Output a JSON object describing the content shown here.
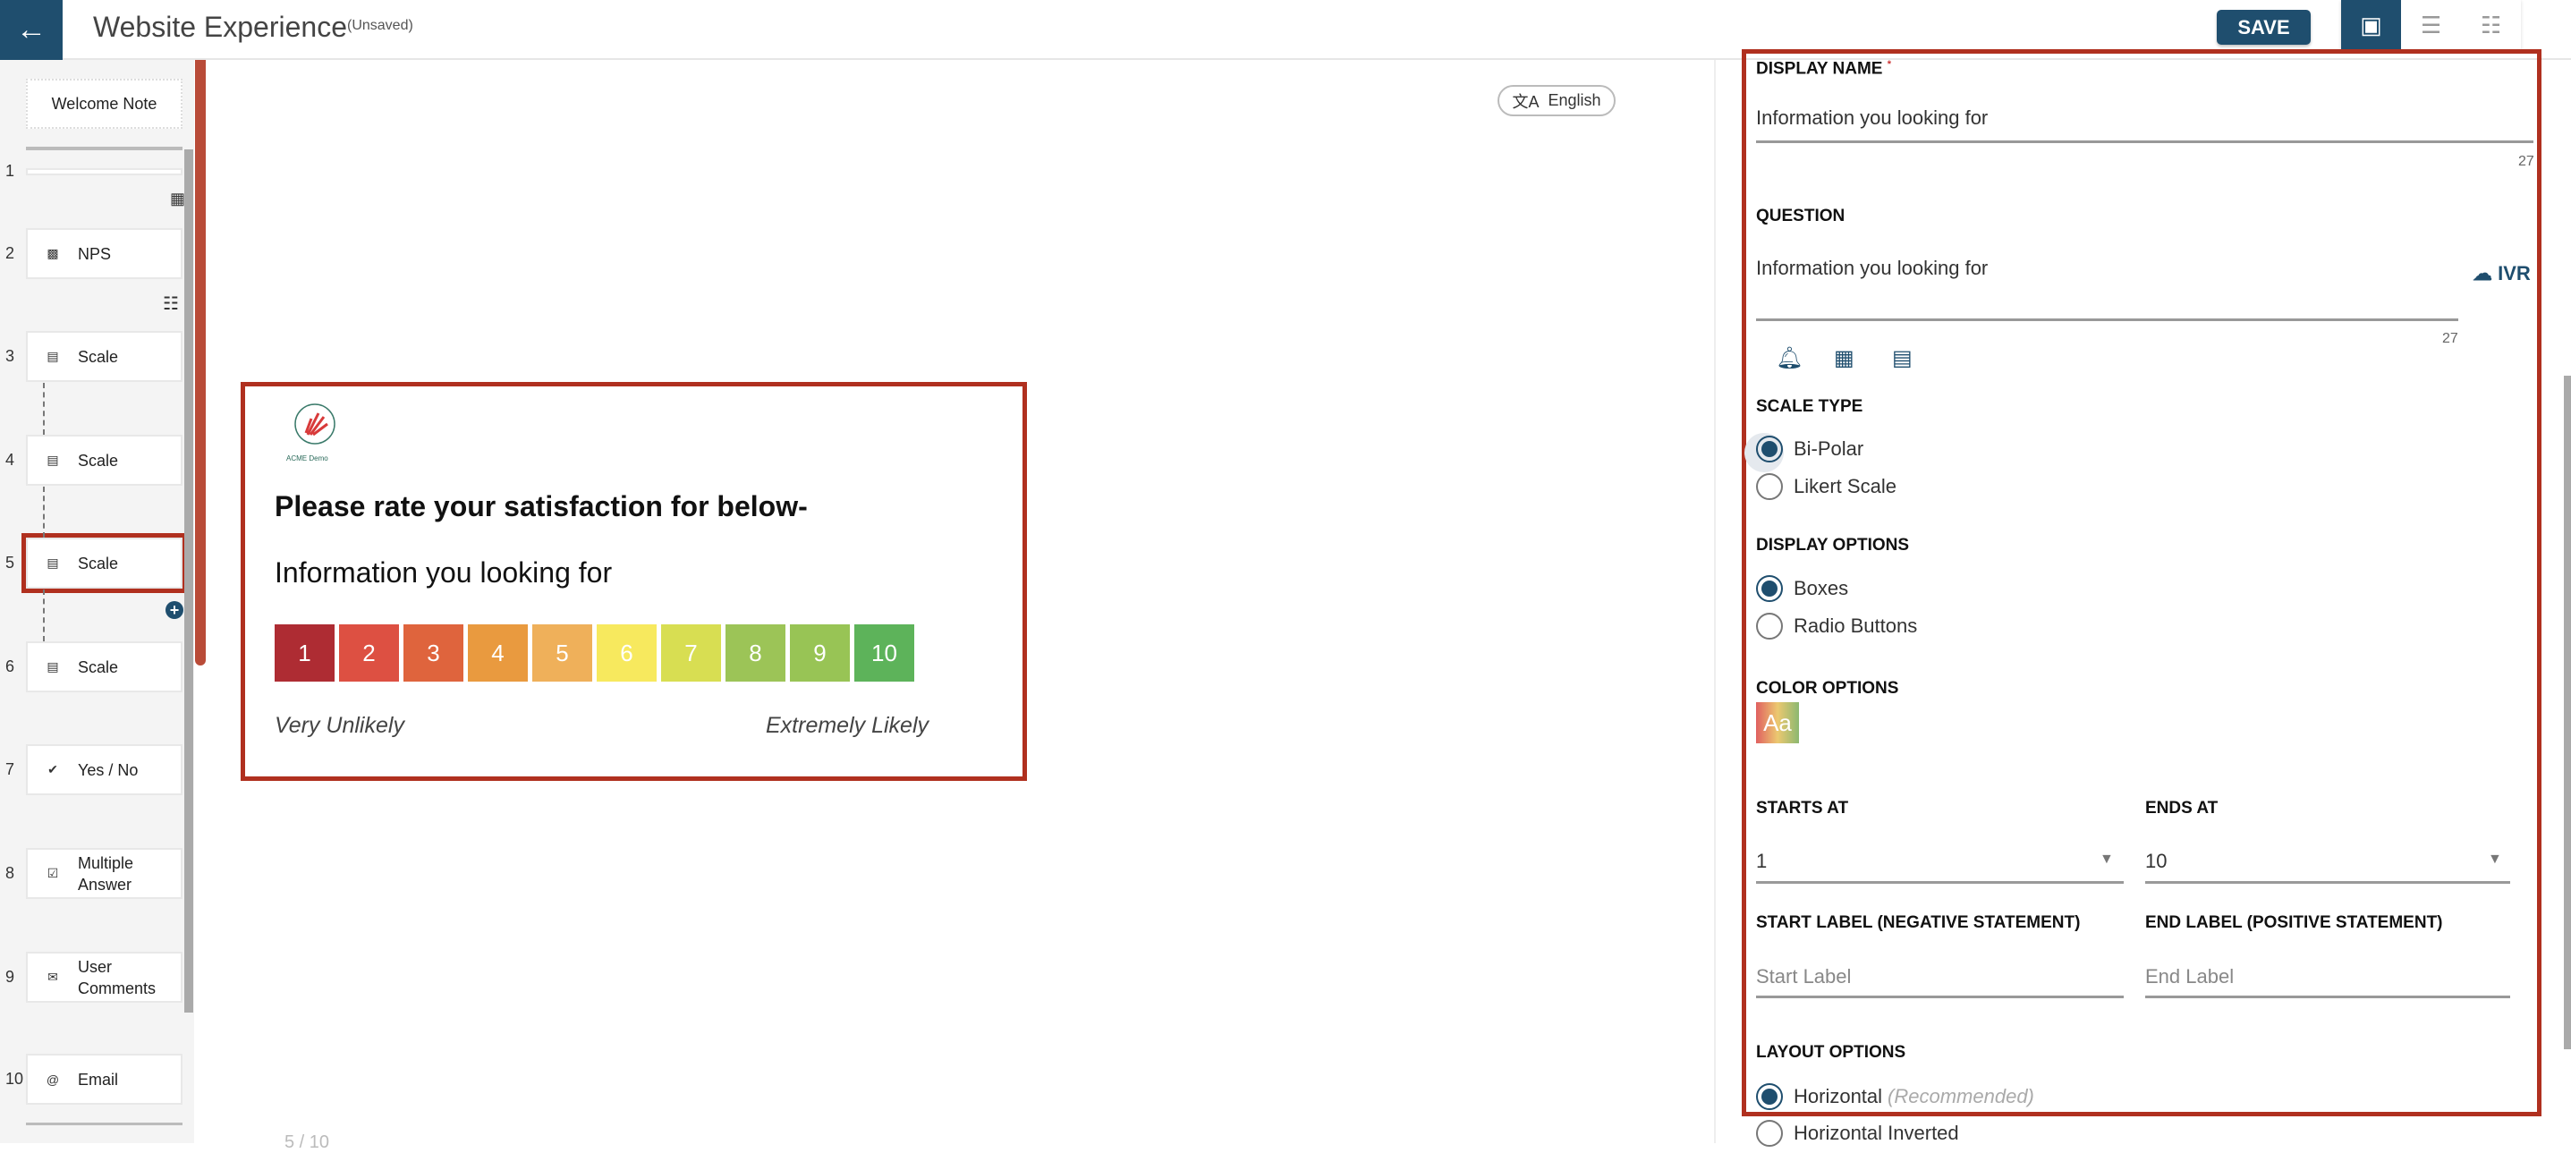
{
  "header": {
    "title": "Website Experience",
    "status": "(Unsaved)",
    "save_label": "SAVE",
    "back_icon": "arrow-left-icon",
    "view_icons": [
      "monitor-icon",
      "list-icon",
      "sitemap-icon"
    ]
  },
  "sidebar": {
    "welcome": "Welcome Note",
    "items": [
      {
        "num": "1",
        "label": "",
        "icon": ""
      },
      {
        "num": "2",
        "label": "NPS",
        "icon": "nps-icon"
      },
      {
        "num": "3",
        "label": "Scale",
        "icon": "scale-icon"
      },
      {
        "num": "4",
        "label": "Scale",
        "icon": "scale-icon"
      },
      {
        "num": "5",
        "label": "Scale",
        "icon": "scale-icon",
        "selected": true
      },
      {
        "num": "6",
        "label": "Scale",
        "icon": "scale-icon"
      },
      {
        "num": "7",
        "label": "Yes / No",
        "icon": "check-badge-icon"
      },
      {
        "num": "8",
        "label": "Multiple Answer",
        "icon": "checklist-icon"
      },
      {
        "num": "9",
        "label": "User Comments",
        "icon": "comment-icon"
      },
      {
        "num": "10",
        "label": "Email",
        "icon": "at-icon"
      }
    ]
  },
  "preview": {
    "language": "English",
    "logo_text": "ACME Demo",
    "heading": "Please rate your satisfaction for below-",
    "question": "Information you looking for",
    "scale": [
      {
        "v": "1",
        "c": "#ae2c33"
      },
      {
        "v": "2",
        "c": "#dd5042"
      },
      {
        "v": "3",
        "c": "#df643d"
      },
      {
        "v": "4",
        "c": "#e99a3f"
      },
      {
        "v": "5",
        "c": "#efb05a"
      },
      {
        "v": "6",
        "c": "#f7e95e"
      },
      {
        "v": "7",
        "c": "#d8de52"
      },
      {
        "v": "8",
        "c": "#9cc457"
      },
      {
        "v": "9",
        "c": "#98c455"
      },
      {
        "v": "10",
        "c": "#5db35a"
      }
    ],
    "start_label": "Very Unlikely",
    "end_label": "Extremely Likely",
    "pager": "5 / 10"
  },
  "panel": {
    "display_name_label": "DISPLAY NAME",
    "required_mark": "*",
    "display_name": "Information you looking for",
    "display_count": "27",
    "question_label": "QUESTION",
    "question": "Information you looking for",
    "question_count": "27",
    "ivr": "IVR",
    "scale_type_label": "SCALE TYPE",
    "scale_types": [
      "Bi-Polar",
      "Likert Scale"
    ],
    "scale_type_selected": "Bi-Polar",
    "display_options_label": "DISPLAY OPTIONS",
    "display_options": [
      "Boxes",
      "Radio Buttons"
    ],
    "display_option_selected": "Boxes",
    "color_options_label": "COLOR OPTIONS",
    "color_swatch": "Aa",
    "starts_at_label": "STARTS AT",
    "starts_at": "1",
    "ends_at_label": "ENDS AT",
    "ends_at": "10",
    "start_label_label": "START LABEL (NEGATIVE STATEMENT)",
    "start_label_placeholder": "Start Label",
    "end_label_label": "END LABEL (POSITIVE STATEMENT)",
    "end_label_placeholder": "End Label",
    "layout_label": "LAYOUT OPTIONS",
    "layout_options": [
      "Horizontal",
      "Horizontal Inverted"
    ],
    "layout_recommended": "(Recommended)",
    "layout_selected": "Horizontal"
  },
  "colors": {
    "brand": "#1f4e6e",
    "highlight": "#b0301f"
  }
}
